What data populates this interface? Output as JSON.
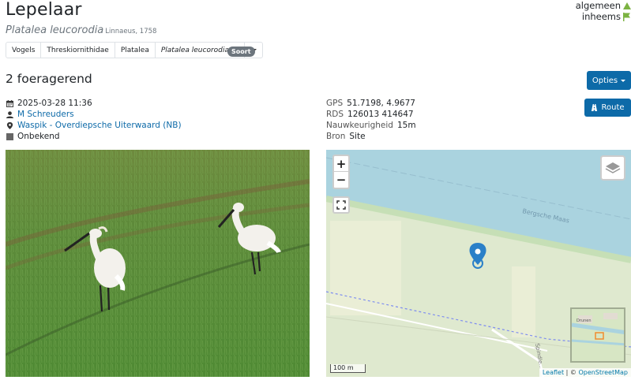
{
  "species": {
    "common_name": "Lepelaar",
    "scientific_name": "Platalea leucorodia",
    "authority": "Linnaeus, 1758"
  },
  "status": {
    "general": "algemeen",
    "native": "inheems",
    "general_color": "#7cb342",
    "native_color": "#7cb342"
  },
  "taxonomy": {
    "items": [
      "Vogels",
      "Threskiornithidae",
      "Platalea",
      "Platalea leucorodia"
    ],
    "rank_badge": "Soort"
  },
  "observation": {
    "count_label": "2 foeragerend",
    "date": "2025-03-28 11:36",
    "observer": "M Schreuders",
    "location": "Waspik - Overdiepsche Uiterwaard (NB)",
    "certainty": "Onbekend"
  },
  "buttons": {
    "options": "Opties",
    "route": "Route"
  },
  "location_meta": {
    "gps_label": "GPS",
    "gps_value": "51.7198, 4.9677",
    "rds_label": "RDS",
    "rds_value": "126013 414647",
    "accuracy_label": "Nauwkeurigheid",
    "accuracy_value": "15m",
    "source_label": "Bron",
    "source_value": "Site"
  },
  "map": {
    "zoom_in": "+",
    "zoom_out": "−",
    "river_label": "Bergsche Maas",
    "road_label": "Spindle...",
    "scale": "100 m",
    "attribution_leaflet": "Leaflet",
    "attribution_sep": " | © ",
    "attribution_osm": "OpenStreetMap",
    "minimap_label": "Drunen"
  },
  "colors": {
    "accent": "#0d6aa8",
    "water": "#aad3df",
    "land": "#dfe9cf"
  }
}
